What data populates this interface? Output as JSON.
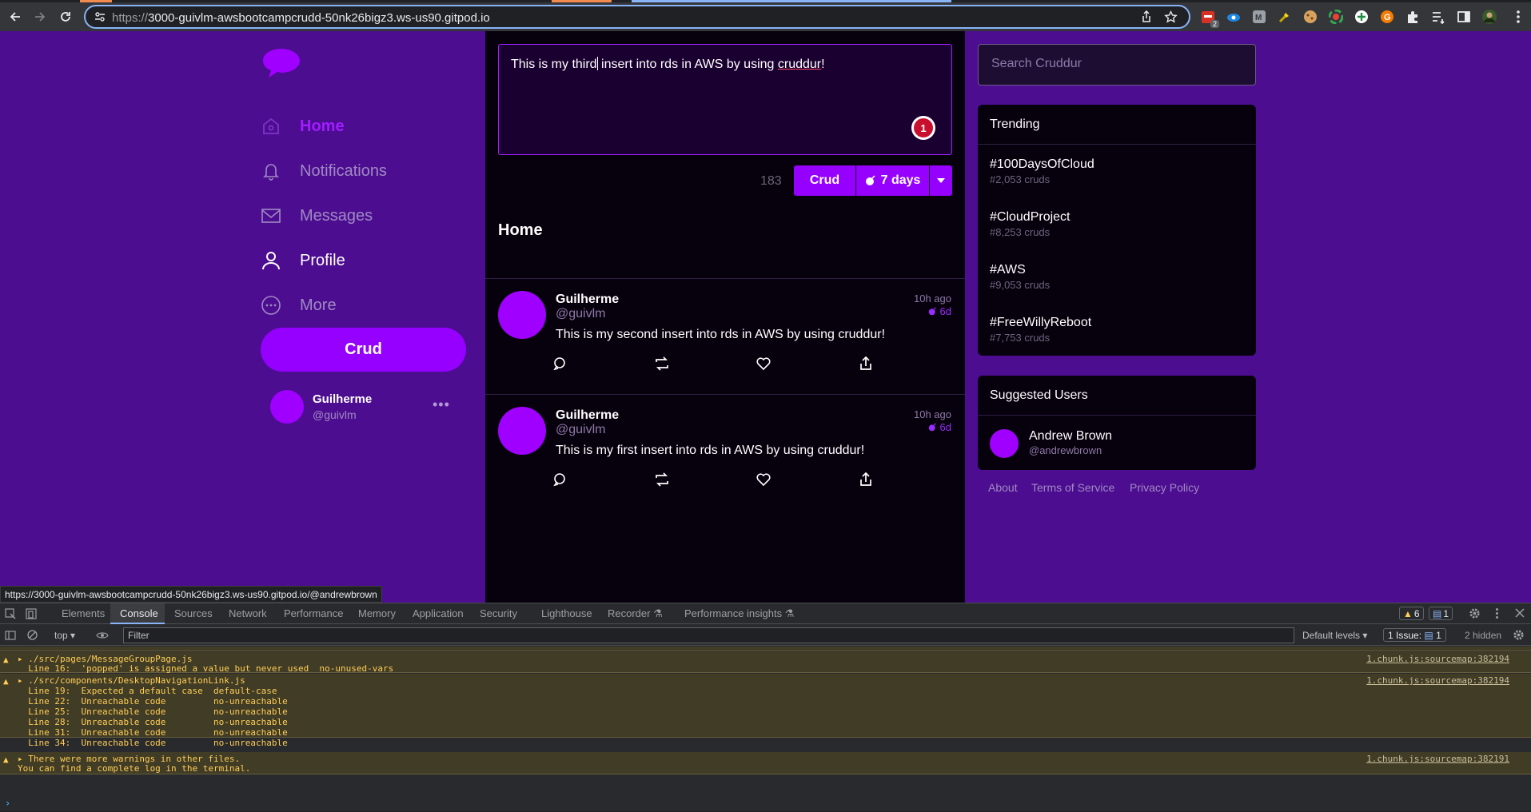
{
  "browser": {
    "url_host": "3000-guivlm-awsbootcampcrudd-50nk26bigz3.ws-us90.gitpod.io",
    "url_prefix": "https://",
    "extension_badge": "2",
    "status_url": "https://3000-guivlm-awsbootcampcrudd-50nk26bigz3.ws-us90.gitpod.io/@andrewbrown"
  },
  "sidebar": {
    "items": [
      {
        "label": "Home",
        "icon": "home-icon"
      },
      {
        "label": "Notifications",
        "icon": "bell-icon"
      },
      {
        "label": "Messages",
        "icon": "envelope-icon"
      },
      {
        "label": "Profile",
        "icon": "user-icon"
      },
      {
        "label": "More",
        "icon": "more-circle-icon"
      }
    ],
    "crud_button": "Crud",
    "profile": {
      "name": "Guilherme",
      "handle": "@guivlm",
      "menu": "•••"
    }
  },
  "compose": {
    "text_before": "This is my third",
    "text_after": " insert into rds in AWS by using ",
    "text_underlined": "cruddur",
    "text_end": "!",
    "badge": "1",
    "char_count": "183",
    "submit_label": "Crud",
    "ttl_label": "7 days"
  },
  "feed": {
    "title": "Home",
    "posts": [
      {
        "name": "Guilherme",
        "handle": "@guivlm",
        "ago": "10h ago",
        "expires": "6d",
        "message": "This is my second insert into rds in AWS by using cruddur!"
      },
      {
        "name": "Guilherme",
        "handle": "@guivlm",
        "ago": "10h ago",
        "expires": "6d",
        "message": "This is my first insert into rds in AWS by using cruddur!"
      }
    ]
  },
  "search": {
    "placeholder": "Search Cruddur"
  },
  "trending": {
    "title": "Trending",
    "items": [
      {
        "tag": "#100DaysOfCloud",
        "count": "#2,053 cruds"
      },
      {
        "tag": "#CloudProject",
        "count": "#8,253 cruds"
      },
      {
        "tag": "#AWS",
        "count": "#9,053 cruds"
      },
      {
        "tag": "#FreeWillyReboot",
        "count": "#7,753 cruds"
      }
    ]
  },
  "suggested": {
    "title": "Suggested Users",
    "users": [
      {
        "name": "Andrew Brown",
        "handle": "@andrewbrown"
      }
    ]
  },
  "footer": {
    "about": "About",
    "terms": "Terms of Service",
    "privacy": "Privacy Policy"
  },
  "devtools": {
    "tabs": [
      "Elements",
      "Console",
      "Sources",
      "Network",
      "Performance",
      "Memory",
      "Application",
      "Security",
      "Lighthouse",
      "Recorder ⚗",
      "Performance insights ⚗"
    ],
    "warnings_count": "6",
    "messages_count": "1",
    "context": "top",
    "filter_placeholder": "Filter",
    "levels": "Default levels",
    "issues": "1 Issue:",
    "issues_count": "1",
    "hidden": "2 hidden",
    "messages": [
      {
        "lines": [
          "▸ ./src/pages/MessageGroupPage.js",
          "  Line 16:  'popped' is assigned a value but never used  no-unused-vars"
        ],
        "source": "1.chunk.js:sourcemap:382194"
      },
      {
        "lines": [
          "▸ ./src/components/DesktopNavigationLink.js",
          "  Line 19:  Expected a default case  default-case",
          "  Line 22:  Unreachable code         no-unreachable",
          "  Line 25:  Unreachable code         no-unreachable",
          "  Line 28:  Unreachable code         no-unreachable",
          "  Line 31:  Unreachable code         no-unreachable",
          "  Line 34:  Unreachable code         no-unreachable"
        ],
        "source": "1.chunk.js:sourcemap:382194"
      },
      {
        "lines": [
          "▸ There were more warnings in other files.",
          "You can find a complete log in the terminal."
        ],
        "source": "1.chunk.js:sourcemap:382191"
      }
    ]
  },
  "colors": {
    "app_bg": "#4c0d91",
    "accent": "#9500ff",
    "feed_bg": "#07000d"
  }
}
